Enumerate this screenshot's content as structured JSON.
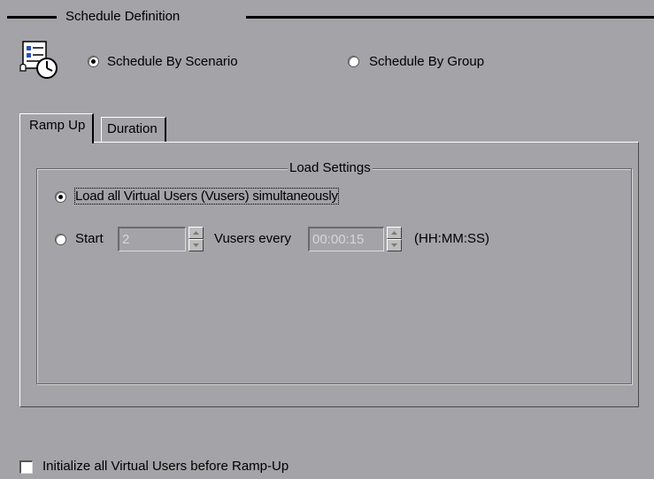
{
  "schedule_definition": {
    "title": "Schedule Definition",
    "icon": "schedule-scenario-icon",
    "options": [
      {
        "label": "Schedule By Scenario",
        "selected": true
      },
      {
        "label": "Schedule By Group",
        "selected": false
      }
    ]
  },
  "tabs": [
    {
      "label": "Ramp Up",
      "active": true
    },
    {
      "label": "Duration",
      "active": false
    }
  ],
  "load_settings": {
    "title": "Load Settings",
    "option_all": {
      "label": "Load all Virtual Users (Vusers) simultaneously",
      "selected": true
    },
    "option_start": {
      "label": "Start",
      "selected": false,
      "vusers_value": "2",
      "vusers_label": "Vusers every",
      "interval_value": "00:00:15",
      "interval_format": "(HH:MM:SS)"
    }
  },
  "initialize": {
    "label": "Initialize all Virtual Users before Ramp-Up",
    "checked": false
  }
}
